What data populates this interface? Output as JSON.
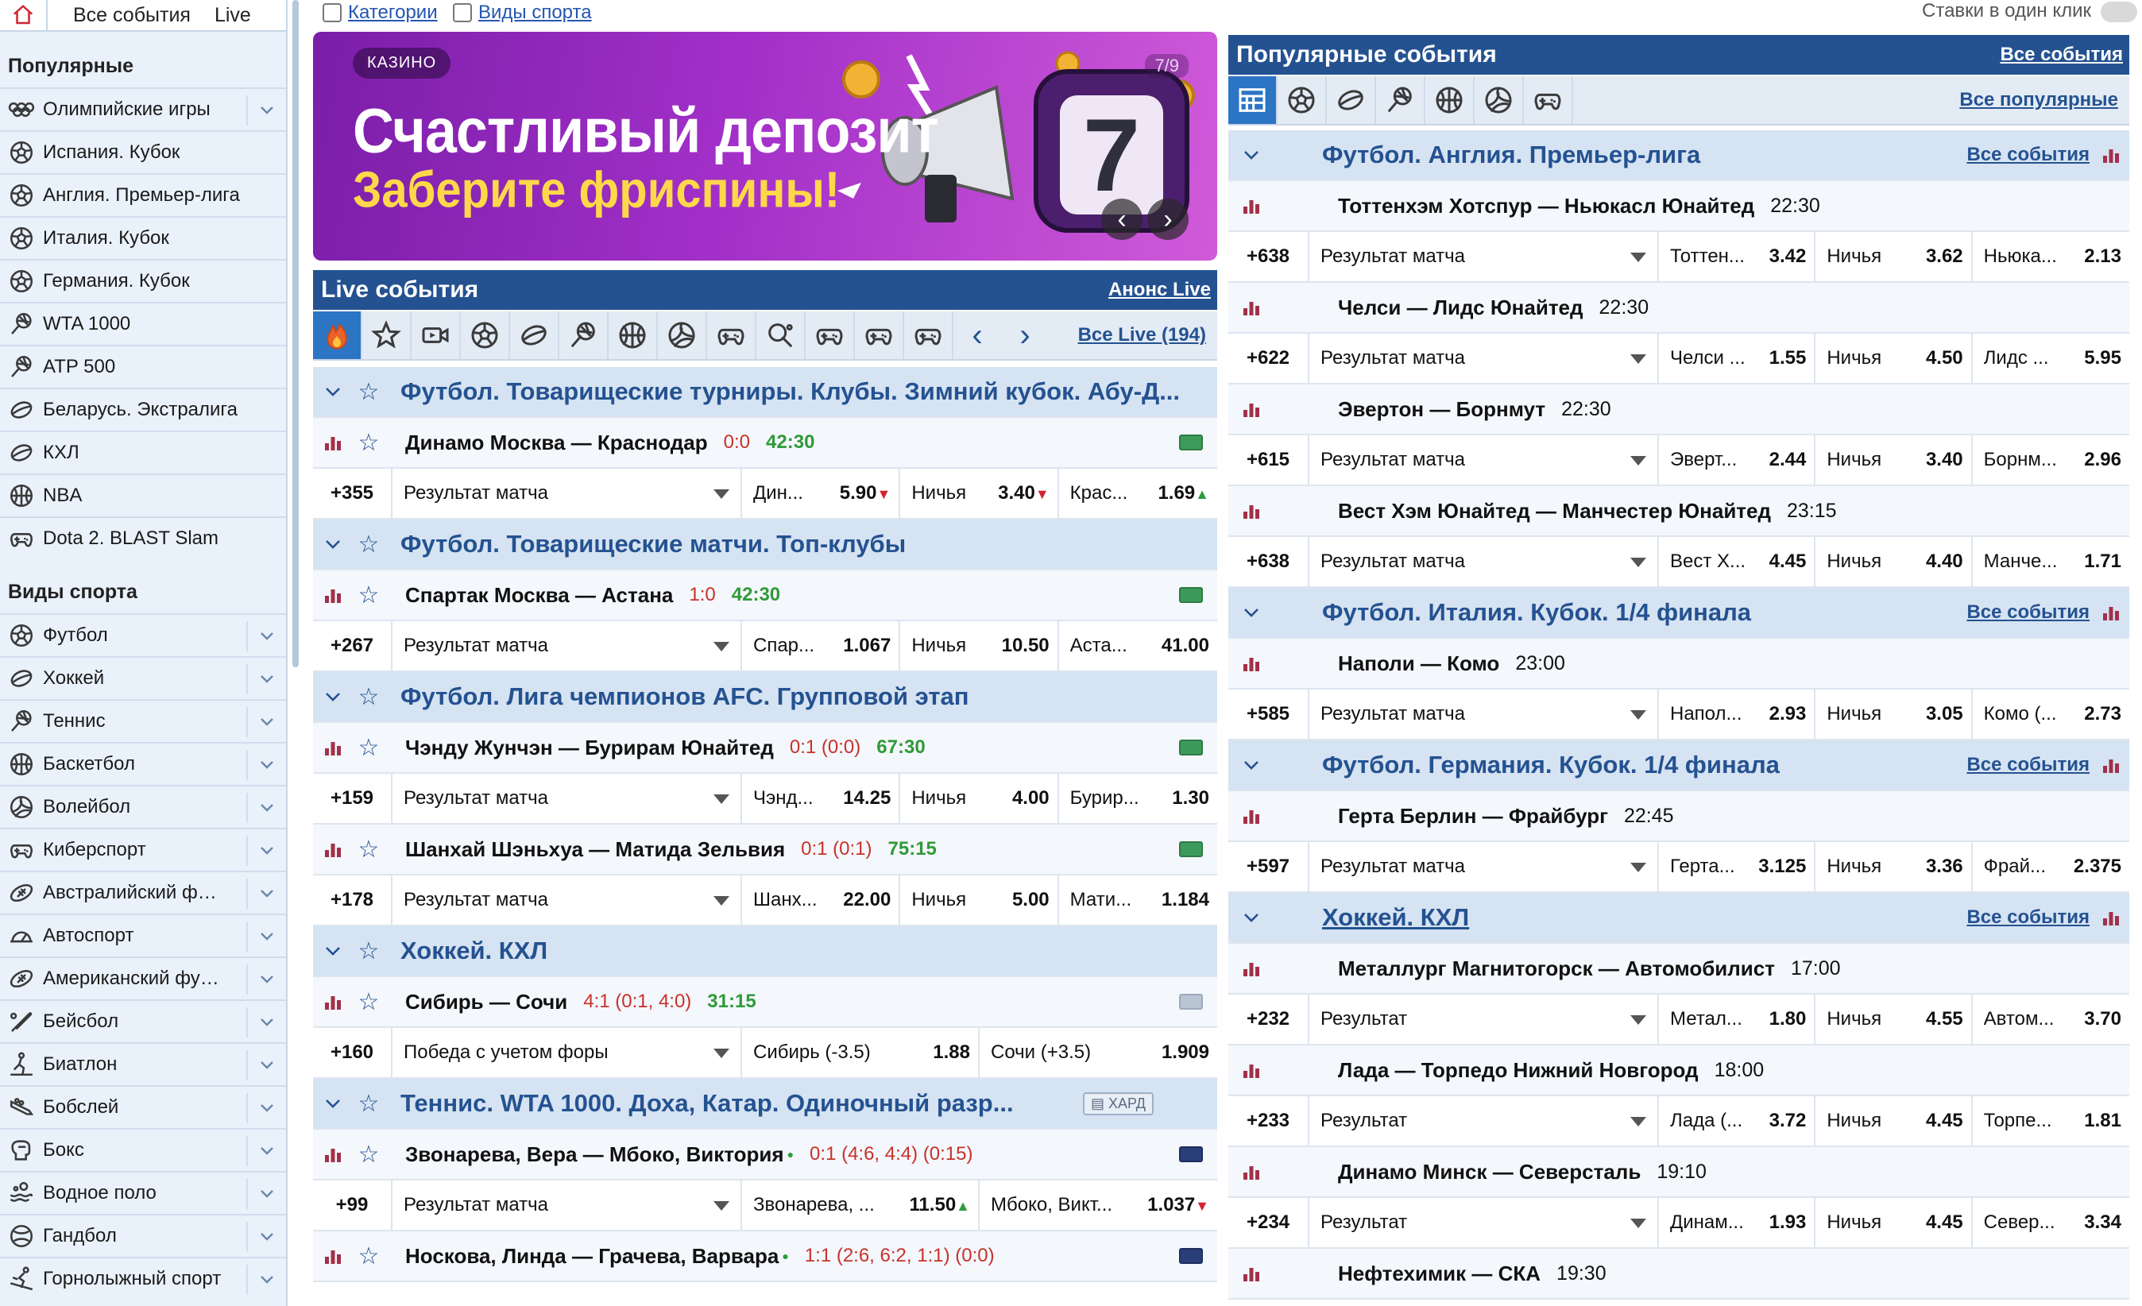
{
  "sidebar": {
    "top_tabs": [
      "Все события",
      "Live"
    ],
    "popular_title": "Популярные",
    "popular": [
      {
        "label": "Олимпийские игры",
        "icon": "olympic-rings-icon",
        "expand": true
      },
      {
        "label": "Испания. Кубок",
        "icon": "football-icon"
      },
      {
        "label": "Англия. Премьер-лига",
        "icon": "football-icon"
      },
      {
        "label": "Италия. Кубок",
        "icon": "football-icon"
      },
      {
        "label": "Германия. Кубок",
        "icon": "football-icon"
      },
      {
        "label": "WTA 1000",
        "icon": "tennis-icon"
      },
      {
        "label": "ATP 500",
        "icon": "tennis-icon"
      },
      {
        "label": "Беларусь. Экстралига",
        "icon": "hockey-icon"
      },
      {
        "label": "КХЛ",
        "icon": "hockey-icon"
      },
      {
        "label": "NBA",
        "icon": "basketball-icon"
      },
      {
        "label": "Dota 2. BLAST Slam",
        "icon": "gamepad-icon"
      }
    ],
    "sports_title": "Виды спорта",
    "sports": [
      {
        "label": "Футбол",
        "icon": "football-icon"
      },
      {
        "label": "Хоккей",
        "icon": "hockey-icon"
      },
      {
        "label": "Теннис",
        "icon": "tennis-icon"
      },
      {
        "label": "Баскетбол",
        "icon": "basketball-icon"
      },
      {
        "label": "Волейбол",
        "icon": "volleyball-icon"
      },
      {
        "label": "Киберспорт",
        "icon": "gamepad-icon"
      },
      {
        "label": "Австралийский ф…",
        "icon": "rugby-ball-icon"
      },
      {
        "label": "Автоспорт",
        "icon": "speedometer-icon"
      },
      {
        "label": "Американский фу…",
        "icon": "rugby-ball-icon"
      },
      {
        "label": "Бейсбол",
        "icon": "baseball-bat-icon"
      },
      {
        "label": "Биатлон",
        "icon": "biathlon-icon"
      },
      {
        "label": "Бобслей",
        "icon": "bobsleigh-icon"
      },
      {
        "label": "Бокс",
        "icon": "boxing-glove-icon"
      },
      {
        "label": "Водное поло",
        "icon": "water-polo-icon"
      },
      {
        "label": "Гандбол",
        "icon": "handball-icon"
      },
      {
        "label": "Горнолыжный спорт",
        "icon": "skiing-icon"
      }
    ]
  },
  "topbar": {
    "categories": "Категории",
    "sports_types": "Виды спорта",
    "one_click": "Ставки в один клик"
  },
  "banner": {
    "tag": "КАЗИНО",
    "title": "Счастливый депозит",
    "subtitle": "Заберите фриспины!",
    "page": "7/9"
  },
  "live": {
    "title": "Live события",
    "announce": "Анонс Live",
    "all_live": "Все Live (194)",
    "sports": [
      "fire-icon",
      "star-icon",
      "video-icon",
      "football-icon",
      "hockey-icon",
      "tennis-icon",
      "basketball-icon",
      "volleyball-icon",
      "gamepad-icon",
      "table-tennis-icon",
      "gamepad-icon",
      "gamepad-icon",
      "gamepad-icon"
    ],
    "rows": [
      {
        "type": "group",
        "title": "Футбол. Товарищеские турниры. Клубы. Зимний кубок. Абу-Д..."
      },
      {
        "type": "match",
        "name": "Динамо Москва — Краснодар",
        "score": "0:0",
        "time": "42:30",
        "live": "green"
      },
      {
        "type": "odds",
        "count": "+355",
        "market": "Результат матча",
        "odds": [
          {
            "n": "Дин...",
            "v": "5.90",
            "t": "down"
          },
          {
            "n": "Ничья",
            "v": "3.40",
            "t": "down"
          },
          {
            "n": "Крас...",
            "v": "1.69",
            "t": "up"
          }
        ]
      },
      {
        "type": "group",
        "title": "Футбол. Товарищеские матчи. Топ-клубы"
      },
      {
        "type": "match",
        "name": "Спартак Москва — Астана",
        "score": "1:0",
        "time": "42:30",
        "live": "green"
      },
      {
        "type": "odds",
        "count": "+267",
        "market": "Результат матча",
        "odds": [
          {
            "n": "Спар...",
            "v": "1.067"
          },
          {
            "n": "Ничья",
            "v": "10.50"
          },
          {
            "n": "Аста...",
            "v": "41.00"
          }
        ]
      },
      {
        "type": "group",
        "title": "Футбол. Лига чемпионов AFC. Групповой этап"
      },
      {
        "type": "match",
        "name": "Чэнду Жунчэн — Бурирам Юнайтед",
        "score": "0:1 (0:0)",
        "time": "67:30",
        "live": "green"
      },
      {
        "type": "odds",
        "count": "+159",
        "market": "Результат матча",
        "odds": [
          {
            "n": "Чэнд...",
            "v": "14.25"
          },
          {
            "n": "Ничья",
            "v": "4.00"
          },
          {
            "n": "Бурир...",
            "v": "1.30"
          }
        ]
      },
      {
        "type": "match",
        "name": "Шанхай Шэньхуа — Матида Зельвия",
        "score": "0:1 (0:1)",
        "time": "75:15",
        "live": "green"
      },
      {
        "type": "odds",
        "count": "+178",
        "market": "Результат матча",
        "odds": [
          {
            "n": "Шанх...",
            "v": "22.00"
          },
          {
            "n": "Ничья",
            "v": "5.00"
          },
          {
            "n": "Мати...",
            "v": "1.184"
          }
        ]
      },
      {
        "type": "group",
        "title": "Хоккей. КХЛ"
      },
      {
        "type": "match",
        "name": "Сибирь — Сочи",
        "score": "4:1 (0:1, 4:0)",
        "time": "31:15",
        "live": "grey"
      },
      {
        "type": "odds",
        "count": "+160",
        "market": "Победа с учетом форы",
        "odds": [
          {
            "n": "Сибирь (-3.5)",
            "v": "1.88"
          },
          {
            "n": "Сочи (+3.5)",
            "v": "1.909"
          }
        ],
        "two": true
      },
      {
        "type": "group",
        "title": "Теннис. WTA 1000. Доха, Катар. Одиночный разр...",
        "badge": "ХАРД"
      },
      {
        "type": "match",
        "name": "Звонарева, Вера — Мбоко, Виктория",
        "score": "0:1 (4:6, 4:4) (0:15)",
        "live": "tennis"
      },
      {
        "type": "odds",
        "count": "+99",
        "market": "Результат матча",
        "odds": [
          {
            "n": "Звонарева, ...",
            "v": "11.50",
            "t": "up"
          },
          {
            "n": "Мбоко, Викт...",
            "v": "1.037",
            "t": "down"
          }
        ],
        "two": true
      },
      {
        "type": "match",
        "name": "Носкова, Линда — Грачева, Варвара",
        "score": "1:1 (2:6, 6:2, 1:1) (0:0)",
        "live": "tennis"
      }
    ]
  },
  "popular": {
    "title": "Популярные события",
    "all_events": "Все события",
    "all_popular": "Все популярные",
    "sports": [
      "table-icon",
      "football-icon",
      "hockey-icon",
      "tennis-icon",
      "basketball-icon",
      "volleyball-icon",
      "gamepad-icon"
    ],
    "rows": [
      {
        "type": "group",
        "title": "Футбол. Англия. Премьер-лига",
        "link": "Все события"
      },
      {
        "type": "match",
        "name": "Тоттенхэм Хотспур — Ньюкасл Юнайтед",
        "ktime": "22:30"
      },
      {
        "type": "odds",
        "count": "+638",
        "market": "Результат матча",
        "odds": [
          {
            "n": "Тоттен...",
            "v": "3.42"
          },
          {
            "n": "Ничья",
            "v": "3.62"
          },
          {
            "n": "Ньюка...",
            "v": "2.13"
          }
        ]
      },
      {
        "type": "match",
        "name": "Челси — Лидс Юнайтед",
        "ktime": "22:30"
      },
      {
        "type": "odds",
        "count": "+622",
        "market": "Результат матча",
        "odds": [
          {
            "n": "Челси ...",
            "v": "1.55"
          },
          {
            "n": "Ничья",
            "v": "4.50"
          },
          {
            "n": "Лидс ...",
            "v": "5.95"
          }
        ]
      },
      {
        "type": "match",
        "name": "Эвертон — Борнмут",
        "ktime": "22:30"
      },
      {
        "type": "odds",
        "count": "+615",
        "market": "Результат матча",
        "odds": [
          {
            "n": "Эверт...",
            "v": "2.44"
          },
          {
            "n": "Ничья",
            "v": "3.40"
          },
          {
            "n": "Борнм...",
            "v": "2.96"
          }
        ]
      },
      {
        "type": "match",
        "name": "Вест Хэм Юнайтед — Манчестер Юнайтед",
        "ktime": "23:15"
      },
      {
        "type": "odds",
        "count": "+638",
        "market": "Результат матча",
        "odds": [
          {
            "n": "Вест Х...",
            "v": "4.45"
          },
          {
            "n": "Ничья",
            "v": "4.40"
          },
          {
            "n": "Манче...",
            "v": "1.71"
          }
        ]
      },
      {
        "type": "group",
        "title": "Футбол. Италия. Кубок. 1/4 финала",
        "link": "Все события"
      },
      {
        "type": "match",
        "name": "Наполи — Комо",
        "ktime": "23:00"
      },
      {
        "type": "odds",
        "count": "+585",
        "market": "Результат матча",
        "odds": [
          {
            "n": "Напол...",
            "v": "2.93"
          },
          {
            "n": "Ничья",
            "v": "3.05"
          },
          {
            "n": "Комо (...",
            "v": "2.73"
          }
        ]
      },
      {
        "type": "group",
        "title": "Футбол. Германия. Кубок. 1/4 финала",
        "link": "Все события"
      },
      {
        "type": "match",
        "name": "Герта Берлин — Фрайбург",
        "ktime": "22:45"
      },
      {
        "type": "odds",
        "count": "+597",
        "market": "Результат матча",
        "odds": [
          {
            "n": "Герта...",
            "v": "3.125"
          },
          {
            "n": "Ничья",
            "v": "3.36"
          },
          {
            "n": "Фрай...",
            "v": "2.375"
          }
        ]
      },
      {
        "type": "group",
        "title": "Хоккей. КХЛ",
        "link": "Все события",
        "underline": true
      },
      {
        "type": "match",
        "name": "Металлург Магнитогорск — Автомобилист",
        "ktime": "17:00"
      },
      {
        "type": "odds",
        "count": "+232",
        "market": "Результат",
        "odds": [
          {
            "n": "Метал...",
            "v": "1.80"
          },
          {
            "n": "Ничья",
            "v": "4.55"
          },
          {
            "n": "Автом...",
            "v": "3.70"
          }
        ]
      },
      {
        "type": "match",
        "name": "Лада — Торпедо Нижний Новгород",
        "ktime": "18:00"
      },
      {
        "type": "odds",
        "count": "+233",
        "market": "Результат",
        "odds": [
          {
            "n": "Лада (...",
            "v": "3.72"
          },
          {
            "n": "Ничья",
            "v": "4.45"
          },
          {
            "n": "Торпе...",
            "v": "1.81"
          }
        ]
      },
      {
        "type": "match",
        "name": "Динамо Минск — Северсталь",
        "ktime": "19:10"
      },
      {
        "type": "odds",
        "count": "+234",
        "market": "Результат",
        "odds": [
          {
            "n": "Динам...",
            "v": "1.93"
          },
          {
            "n": "Ничья",
            "v": "4.45"
          },
          {
            "n": "Север...",
            "v": "3.34"
          }
        ]
      },
      {
        "type": "match",
        "name": "Нефтехимик — СКА",
        "ktime": "19:30"
      }
    ]
  },
  "colors": {
    "brand": "#245291",
    "group_bg": "#d6e3f2",
    "sidebar_bg": "#e9f1fa",
    "up": "#2e9b3d",
    "down": "#d0252f",
    "chart_icon": "#a2304a"
  }
}
